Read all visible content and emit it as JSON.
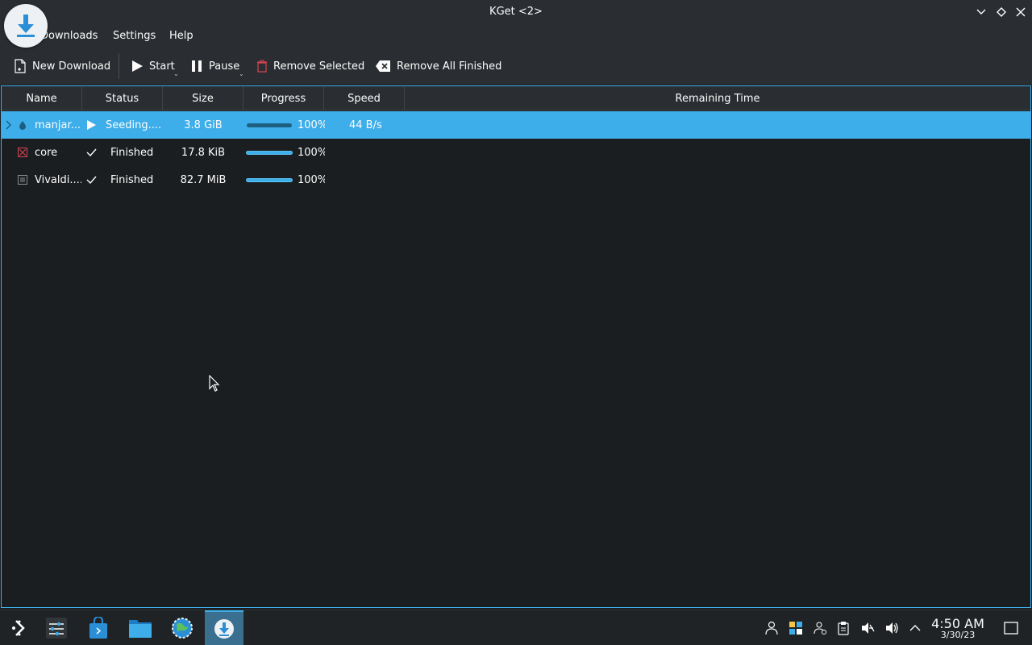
{
  "window": {
    "title": "KGet <2>"
  },
  "menubar": {
    "items": [
      {
        "label": "Downloads"
      },
      {
        "label": "Settings"
      },
      {
        "label": "Help"
      }
    ]
  },
  "toolbar": {
    "new_download": "New Download",
    "start": "Start",
    "pause": "Pause",
    "remove_selected": "Remove Selected",
    "remove_all_finished": "Remove All Finished"
  },
  "table": {
    "columns": [
      "Name",
      "Status",
      "Size",
      "Progress",
      "Speed",
      "Remaining Time"
    ],
    "rows": [
      {
        "name": "manjar...",
        "status": "Seeding....",
        "status_icon": "play-icon",
        "size": "3.8 GiB",
        "progress": "100%",
        "progress_value": 1.0,
        "speed": "44 B/s",
        "remaining": "",
        "file_icon": "torrent-icon",
        "selected": true
      },
      {
        "name": "core",
        "status": "Finished",
        "status_icon": "check-icon",
        "size": "17.8 KiB",
        "progress": "100%",
        "progress_value": 1.0,
        "speed": "",
        "remaining": "",
        "file_icon": "image-file-icon",
        "selected": false
      },
      {
        "name": "Vivaldi....",
        "status": "Finished",
        "status_icon": "check-icon",
        "size": "82.7 MiB",
        "progress": "100%",
        "progress_value": 1.0,
        "speed": "",
        "remaining": "",
        "file_icon": "package-file-icon",
        "selected": false
      }
    ]
  },
  "taskbar": {
    "apps": [
      "application-launcher-icon",
      "system-settings-sliders-icon",
      "discover-store-icon",
      "file-manager-icon",
      "browser-globe-icon",
      "kget-icon"
    ],
    "clock": {
      "time": "4:50 AM",
      "date": "3/30/23"
    }
  },
  "colors": {
    "accent": "#3daee9",
    "background": "#1b1e20",
    "chrome": "#2a2e32"
  }
}
